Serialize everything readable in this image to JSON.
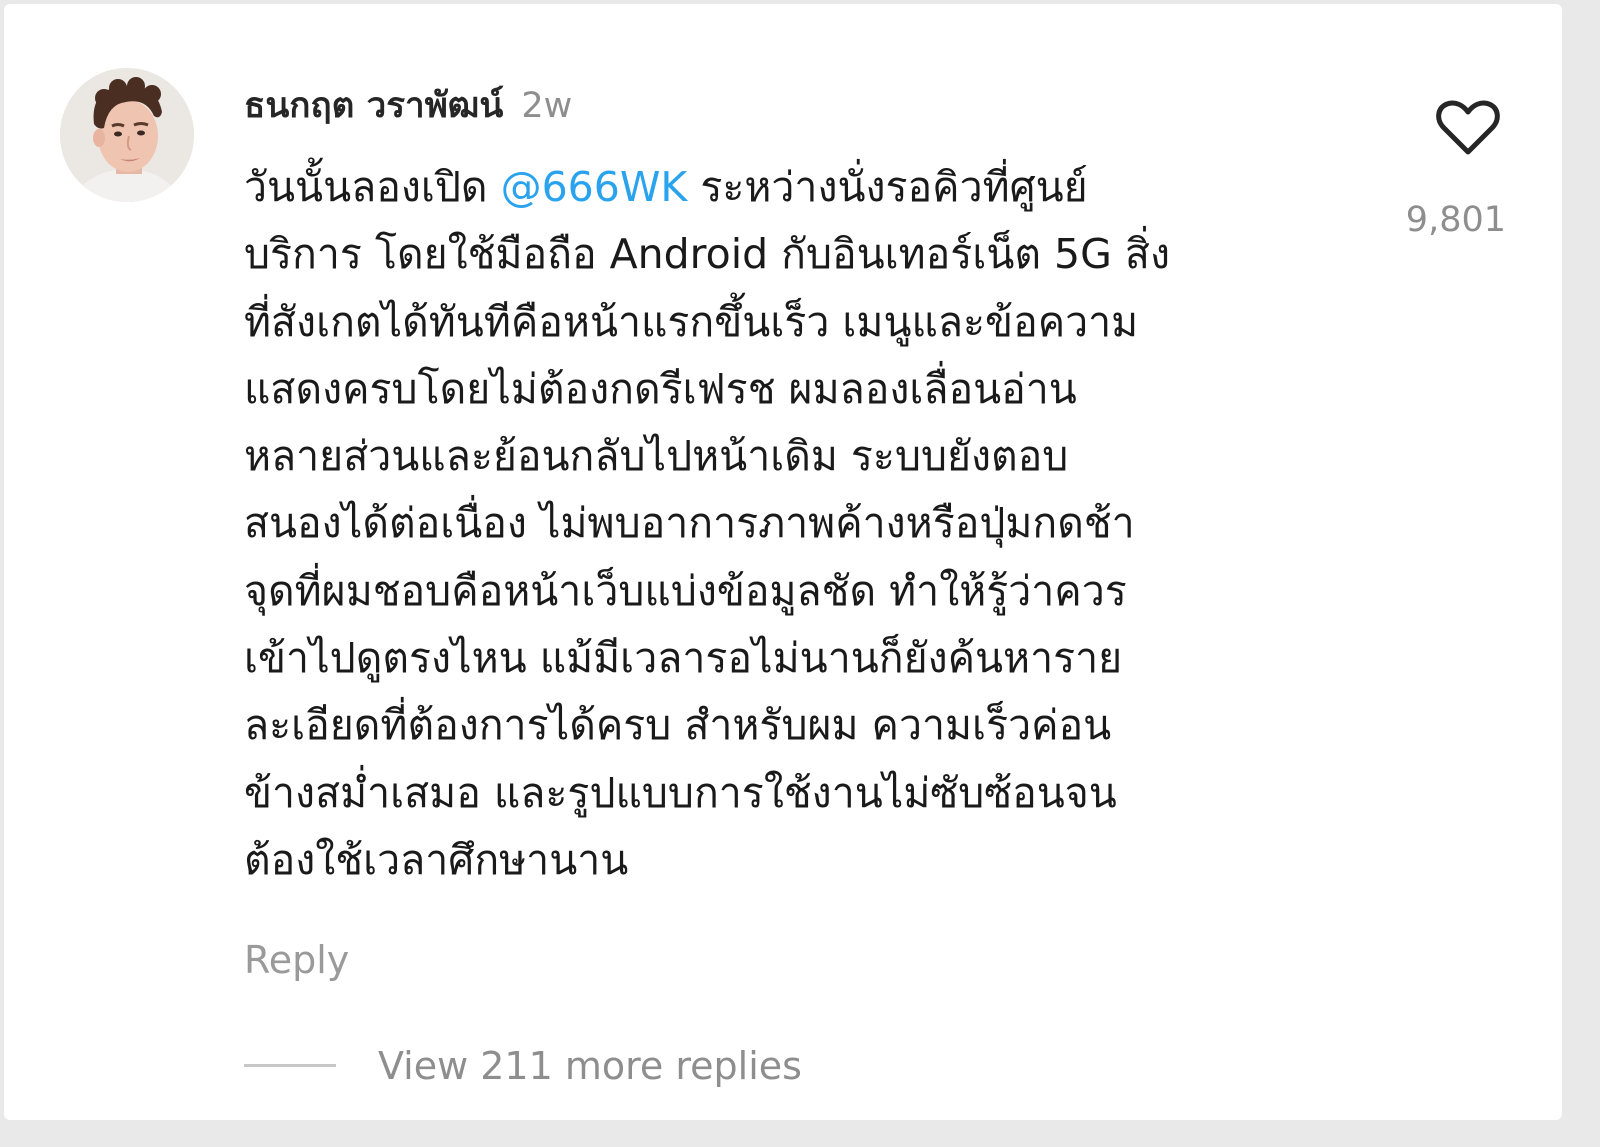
{
  "comment": {
    "username": "ธนกฤต วราพัฒน์",
    "time_ago": "2w",
    "mention": "@666WK",
    "lines": [
      "บริการ โดยใช้มือถือ Android กับอินเทอร์เน็ต 5G สิ่ง",
      "ที่สังเกตได้ทันทีคือหน้าแรกขึ้นเร็ว เมนูและข้อความ",
      "แสดงครบโดยไม่ต้องกดรีเฟรช ผมลองเลื่อนอ่าน",
      "หลายส่วนและย้อนกลับไปหน้าเดิม ระบบยังตอบ",
      "สนองได้ต่อเนื่อง ไม่พบอาการภาพค้างหรือปุ่มกดช้า",
      "จุดที่ผมชอบคือหน้าเว็บแบ่งข้อมูลชัด ทำให้รู้ว่าควร",
      "เข้าไปดูตรงไหน แม้มีเวลารอไม่นานก็ยังค้นหาราย",
      "ละเอียดที่ต้องการได้ครบ สำหรับผม ความเร็วค่อน",
      "ข้างสม่ำเสมอ และรูปแบบการใช้งานไม่ซับซ้อนจน",
      "ต้องใช้เวลาศึกษานาน"
    ],
    "line1_before": "วันนั้นลองเปิด",
    "line1_after": "ระหว่างนั่งรอคิวที่ศูนย์",
    "like_count": "9,801",
    "reply_label": "Reply",
    "view_replies_label": "View 211 more replies"
  },
  "colors": {
    "mention": "#2aa3ef",
    "secondary_text": "#8e8e8e",
    "primary_text": "#1a1a1a"
  },
  "icons": {
    "like": "heart-outline-icon",
    "avatar": "user-avatar-photo"
  }
}
